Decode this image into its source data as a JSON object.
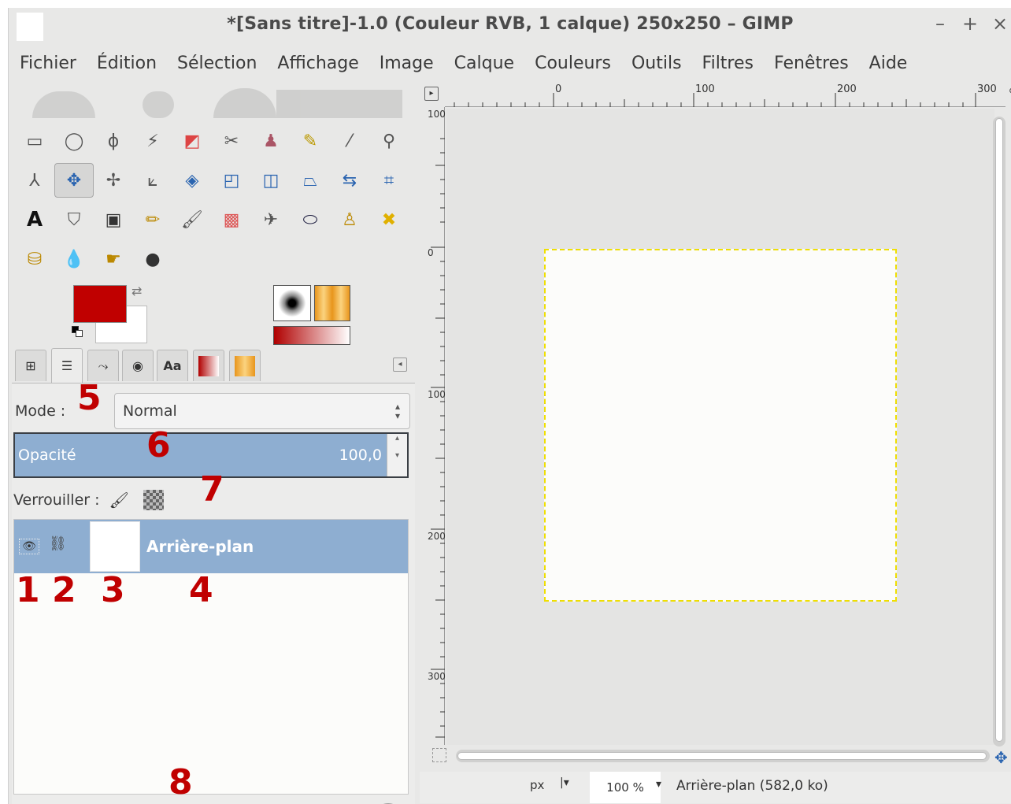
{
  "window": {
    "title": "*[Sans titre]-1.0 (Couleur RVB, 1 calque) 250x250 – GIMP",
    "btn_min": "–",
    "btn_max": "+",
    "btn_close": "×"
  },
  "menu": {
    "items": [
      "Fichier",
      "Édition",
      "Sélection",
      "Affichage",
      "Image",
      "Calque",
      "Couleurs",
      "Outils",
      "Filtres",
      "Fenêtres",
      "Aide"
    ]
  },
  "colors": {
    "foreground": "#c00000",
    "background": "#ffffff",
    "selection": "#8eaed1"
  },
  "toolbox": {
    "active_tool": "move-tool"
  },
  "layers": {
    "mode_label": "Mode :",
    "mode_value": "Normal",
    "opacity_label": "Opacité",
    "opacity_value": "100,0",
    "lock_label": "Verrouiller :",
    "layer_name": "Arrière-plan"
  },
  "annotations": {
    "n1": "1",
    "n2": "2",
    "n3": "3",
    "n4": "4",
    "n5": "5",
    "n6": "6",
    "n7": "7",
    "n8": "8"
  },
  "rulers": {
    "h_labels": [
      "0",
      "100",
      "200",
      "300"
    ],
    "v_labels": [
      "100",
      "0",
      "100",
      "200",
      "300"
    ]
  },
  "status": {
    "unit": "px",
    "zoom": "100 %",
    "info": "Arrière-plan (582,0 ko)"
  }
}
